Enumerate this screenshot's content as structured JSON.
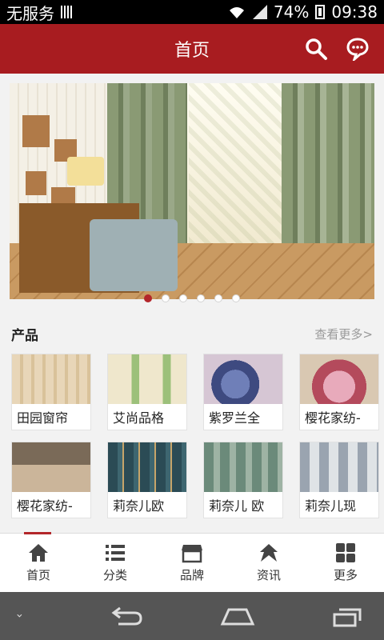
{
  "status_bar": {
    "carrier": "无服务",
    "battery": "74%",
    "time": "09:38"
  },
  "header": {
    "title": "首页"
  },
  "banner": {
    "dots_count": 6,
    "active_dot": 0
  },
  "products": {
    "section_title": "产品",
    "more_label": "查看更多>",
    "items": [
      {
        "name": "田园窗帘"
      },
      {
        "name": "艾尚品格"
      },
      {
        "name": "紫罗兰全"
      },
      {
        "name": "樱花家纺-"
      },
      {
        "name": "樱花家纺-"
      },
      {
        "name": "莉奈儿欧"
      },
      {
        "name": "莉奈儿 欧"
      },
      {
        "name": "莉奈儿现"
      }
    ]
  },
  "tabbar": {
    "tabs": [
      {
        "label": "首页",
        "icon": "home-icon"
      },
      {
        "label": "分类",
        "icon": "list-icon"
      },
      {
        "label": "品牌",
        "icon": "shop-icon"
      },
      {
        "label": "资讯",
        "icon": "news-icon"
      },
      {
        "label": "更多",
        "icon": "grid-icon"
      }
    ],
    "active_tab": 0
  },
  "colors": {
    "brand": "#a81c20",
    "accent": "#b3262a"
  }
}
